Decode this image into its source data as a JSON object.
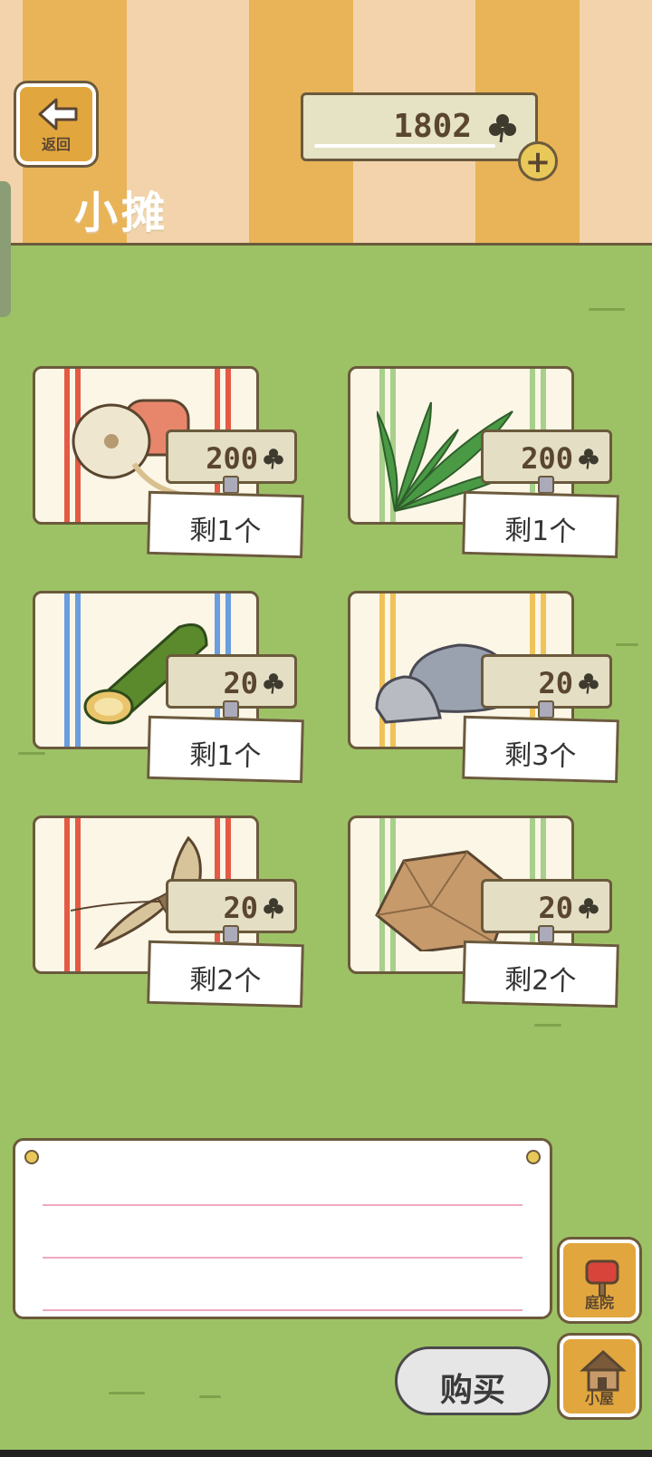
{
  "header": {
    "back_label": "返回",
    "title": "小摊",
    "currency_value": "1802",
    "currency_icon": "clover-icon"
  },
  "items": [
    {
      "name": "线轴",
      "price": "200",
      "stock": "剩1个",
      "stripe_color": "#e45a45"
    },
    {
      "name": "叶子",
      "price": "200",
      "stock": "剩1个",
      "stripe_color": "#a8cf8b"
    },
    {
      "name": "竹筒",
      "price": "20",
      "stock": "剩1个",
      "stripe_color": "#6b9de0"
    },
    {
      "name": "石头",
      "price": "20",
      "stock": "剩3个",
      "stripe_color": "#f0c25a"
    },
    {
      "name": "草束",
      "price": "20",
      "stock": "剩2个",
      "stripe_color": "#e45a45"
    },
    {
      "name": "纸团",
      "price": "20",
      "stock": "剩2个",
      "stripe_color": "#a8cf8b"
    }
  ],
  "nav": {
    "courtyard_label": "庭院",
    "house_label": "小屋"
  },
  "buy_label": "购买",
  "colors": {
    "grass": "#9dc265",
    "stripe_orange": "#e9b457",
    "wood_button": "#e2a63f"
  }
}
